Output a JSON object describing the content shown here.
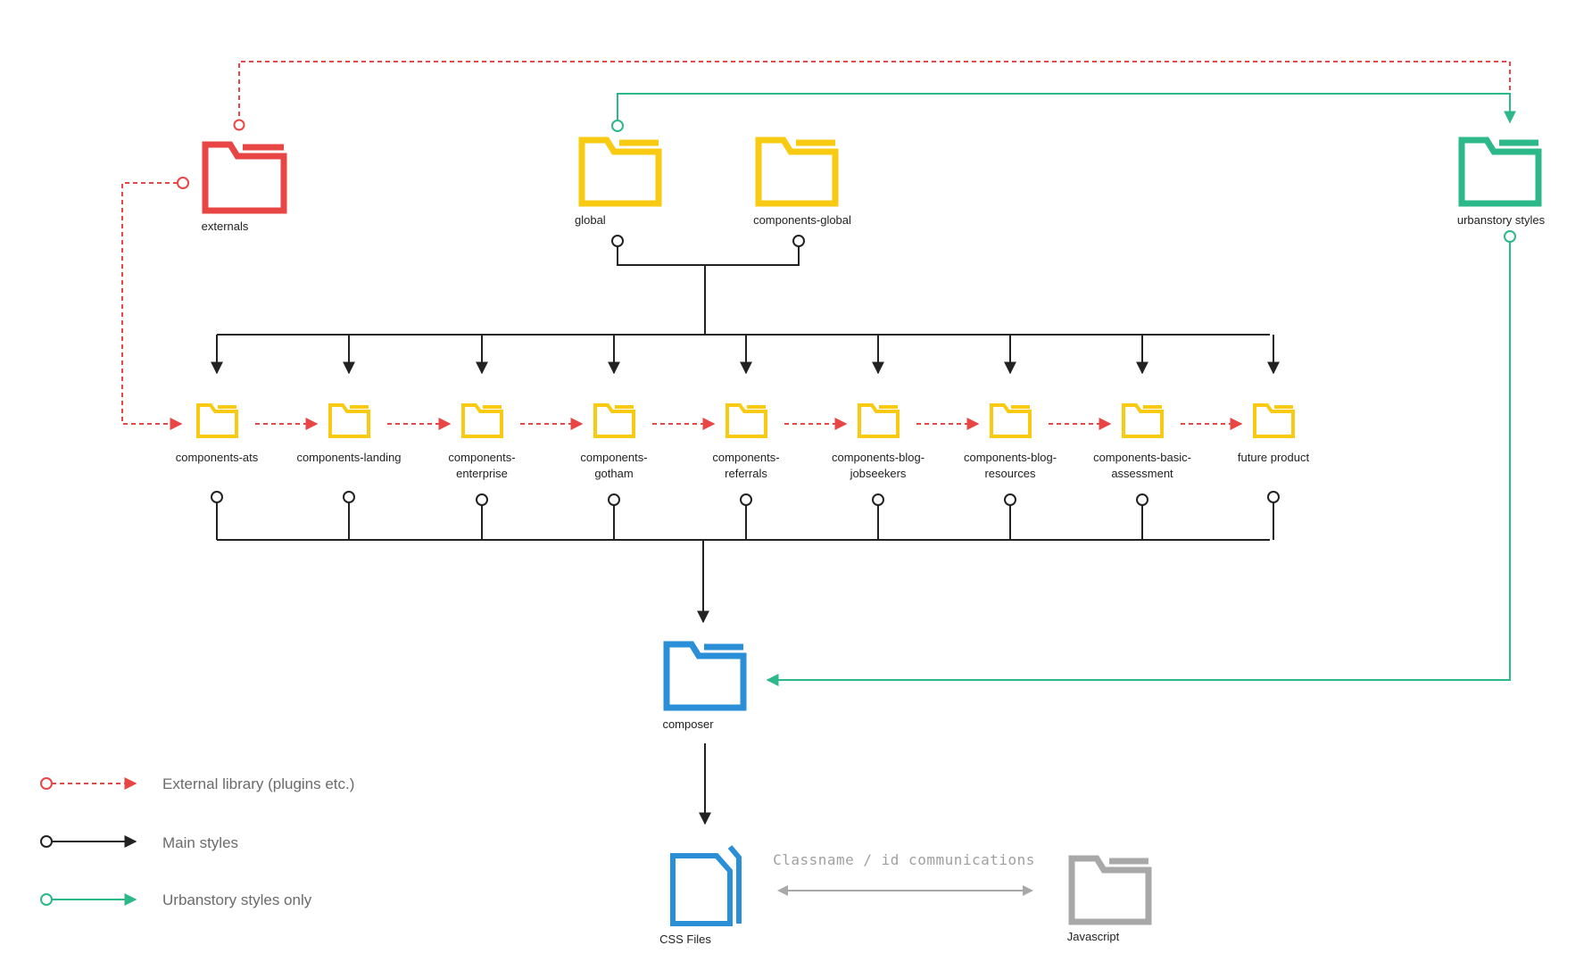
{
  "colors": {
    "external": "#e84545",
    "main": "#222222",
    "urbanstory": "#2db88a",
    "component": "#f8cb12",
    "composer": "#2a8fd6",
    "javascript": "#a8a8a8",
    "legend_text": "#6b6b6b"
  },
  "folders": {
    "externals": "externals",
    "global": "global",
    "components_global": "components-global",
    "urbanstory": "urbanstory styles",
    "composer": "composer",
    "css_files": "CSS Files",
    "javascript": "Javascript"
  },
  "components": [
    {
      "line1": "components-ats",
      "line2": ""
    },
    {
      "line1": "components-landing",
      "line2": ""
    },
    {
      "line1": "components-",
      "line2": "enterprise"
    },
    {
      "line1": "components-",
      "line2": "gotham"
    },
    {
      "line1": "components-",
      "line2": "referrals"
    },
    {
      "line1": "components-blog-",
      "line2": "jobseekers"
    },
    {
      "line1": "components-blog-",
      "line2": "resources"
    },
    {
      "line1": "components-basic-",
      "line2": "assessment"
    },
    {
      "line1": "future product",
      "line2": ""
    }
  ],
  "communication_label": "Classname / id communications",
  "legend": {
    "external": "External library (plugins etc.)",
    "main": "Main styles",
    "urbanstory": "Urbanstory styles only"
  }
}
